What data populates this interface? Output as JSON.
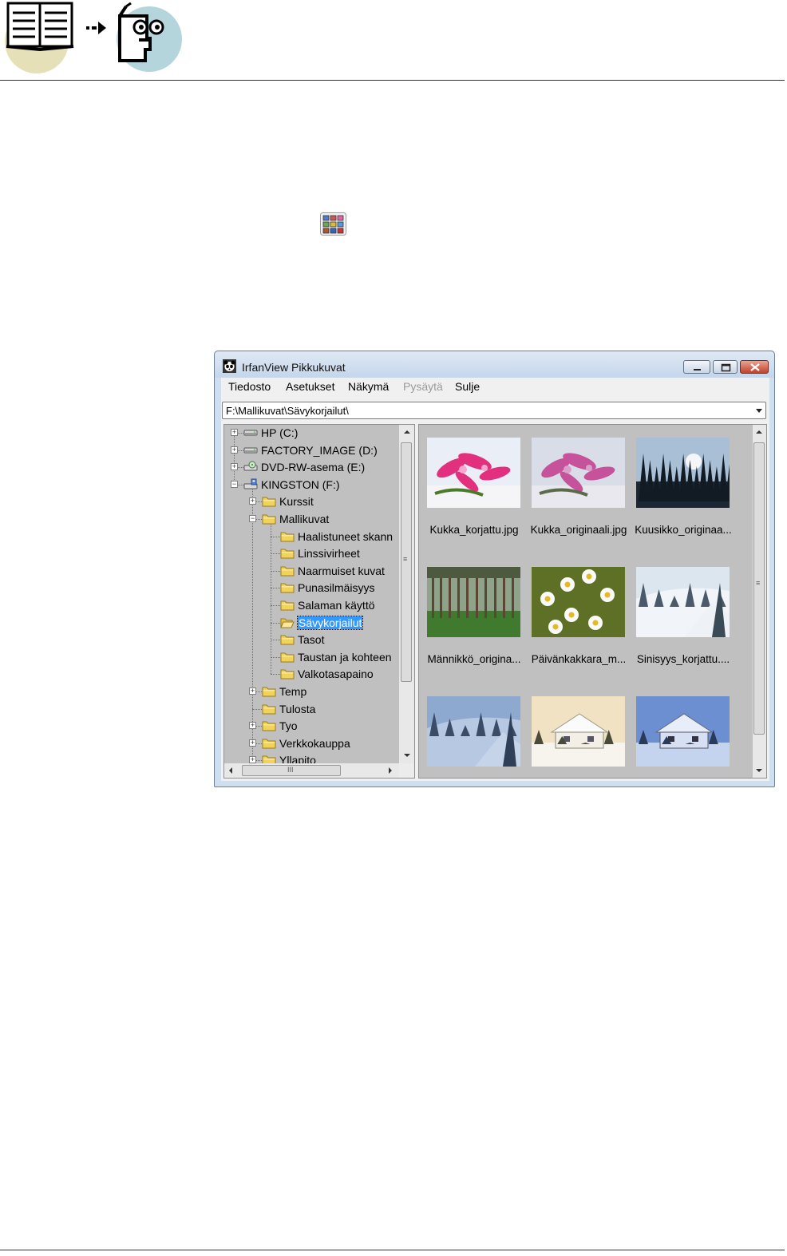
{
  "window": {
    "title": "IrfanView Pikkukuvat"
  },
  "menu": [
    {
      "label": "Tiedosto",
      "disabled": false
    },
    {
      "label": "Asetukset",
      "disabled": false
    },
    {
      "label": "Näkymä",
      "disabled": false
    },
    {
      "label": "Pysäytä",
      "disabled": true
    },
    {
      "label": "Sulje",
      "disabled": false
    }
  ],
  "path": {
    "value": "F:\\Mallikuvat\\Sävykorjailut\\"
  },
  "tree": {
    "items": [
      {
        "label": "HP (C:)",
        "level": 0,
        "icon": "hard-drive-icon",
        "expander": "+"
      },
      {
        "label": "FACTORY_IMAGE (D:)",
        "level": 0,
        "icon": "hard-drive-icon",
        "expander": "+"
      },
      {
        "label": "DVD-RW-asema (E:)",
        "level": 0,
        "icon": "dvd-drive-icon",
        "expander": "+"
      },
      {
        "label": "KINGSTON (F:)",
        "level": 0,
        "icon": "usb-drive-icon",
        "expander": "-"
      },
      {
        "label": "Kurssit",
        "level": 1,
        "icon": "folder-icon",
        "expander": "+"
      },
      {
        "label": "Mallikuvat",
        "level": 1,
        "icon": "folder-icon",
        "expander": "-"
      },
      {
        "label": "Haalistuneet skann",
        "level": 2,
        "icon": "folder-icon",
        "expander": ""
      },
      {
        "label": "Linssivirheet",
        "level": 2,
        "icon": "folder-icon",
        "expander": ""
      },
      {
        "label": "Naarmuiset kuvat",
        "level": 2,
        "icon": "folder-icon",
        "expander": ""
      },
      {
        "label": "Punasilmäisyys",
        "level": 2,
        "icon": "folder-icon",
        "expander": ""
      },
      {
        "label": "Salaman käyttö",
        "level": 2,
        "icon": "folder-icon",
        "expander": ""
      },
      {
        "label": "Sävykorjailut",
        "level": 2,
        "icon": "folder-open-icon",
        "expander": "",
        "selected": true
      },
      {
        "label": "Tasot",
        "level": 2,
        "icon": "folder-icon",
        "expander": ""
      },
      {
        "label": "Taustan ja kohteen",
        "level": 2,
        "icon": "folder-icon",
        "expander": ""
      },
      {
        "label": "Valkotasapaino",
        "level": 2,
        "icon": "folder-icon",
        "expander": ""
      },
      {
        "label": "Temp",
        "level": 1,
        "icon": "folder-icon",
        "expander": "+"
      },
      {
        "label": "Tulosta",
        "level": 1,
        "icon": "folder-icon",
        "expander": ""
      },
      {
        "label": "Tyo",
        "level": 1,
        "icon": "folder-icon",
        "expander": "+"
      },
      {
        "label": "Verkkokauppa",
        "level": 1,
        "icon": "folder-icon",
        "expander": "+"
      },
      {
        "label": "Yllapito",
        "level": 1,
        "icon": "folder-icon",
        "expander": "+"
      }
    ],
    "hscroll_grip": "III"
  },
  "thumbnails": [
    {
      "label": "Kukka_korjattu.jpg",
      "scene": "flower-bright"
    },
    {
      "label": "Kukka_originaali.jpg",
      "scene": "flower-dull"
    },
    {
      "label": "Kuusikko_originaa...",
      "scene": "spruce-forest"
    },
    {
      "label": "Männikkö_origina...",
      "scene": "pine-forest"
    },
    {
      "label": "Päivänkakkara_m...",
      "scene": "daisies"
    },
    {
      "label": "Sinisyys_korjattu....",
      "scene": "snow-hill"
    },
    {
      "label": "",
      "scene": "snow-hill-blue"
    },
    {
      "label": "",
      "scene": "snow-house-warm"
    },
    {
      "label": "",
      "scene": "snow-house-blue"
    }
  ],
  "colors": {
    "selection": "#3399ff",
    "folder": "#f2d35a",
    "pane_bg": "#c0c0c0"
  }
}
